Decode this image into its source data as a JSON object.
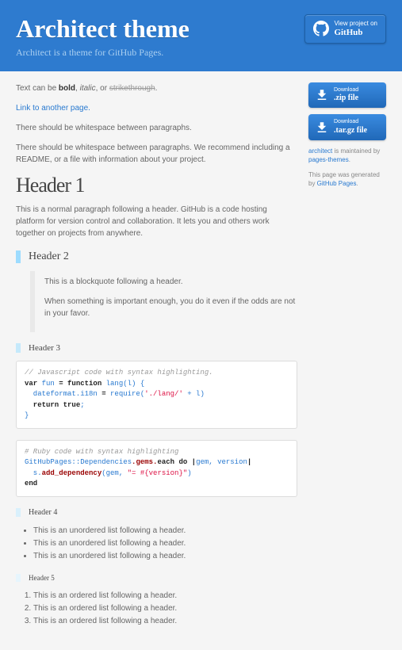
{
  "header": {
    "title": "Architect theme",
    "tagline": "Architect is a theme for GitHub Pages.",
    "github_small": "View project on",
    "github_big": "GitHub"
  },
  "intro": {
    "text_prefix": "Text can be ",
    "bold": "bold",
    "sep1": ", ",
    "italic": "italic",
    "sep2": ", or ",
    "strike": "strikethrough",
    "dot": ".",
    "link": "Link to another page.",
    "p1": "There should be whitespace between paragraphs.",
    "p2": "There should be whitespace between paragraphs. We recommend including a README, or a file with information about your project."
  },
  "h1": "Header 1",
  "h1_p": "This is a normal paragraph following a header. GitHub is a code hosting platform for version control and collaboration. It lets you and others work together on projects from anywhere.",
  "h2": "Header 2",
  "bq1": "This is a blockquote following a header.",
  "bq2": "When something is important enough, you do it even if the odds are not in your favor.",
  "h3": "Header 3",
  "code_js": {
    "c": "// Javascript code with syntax highlighting.",
    "l1a": "var",
    "l1b": " fun ",
    "l1c": "=",
    "l1d": " function",
    "l1e": " lang(l) {",
    "l2a": "  dateformat.i18n ",
    "l2b": "=",
    "l2c": " require(",
    "l2d": "'./lang/'",
    "l2e": " + l)",
    "l3a": "  return",
    "l3b": " true",
    "l3c": ";",
    "l4": "}"
  },
  "code_rb": {
    "c": "# Ruby code with syntax highlighting",
    "l1a": "GitHubPages",
    "l1b": "::",
    "l1c": "Dependencies",
    "l1d": ".gems.",
    "l1e": "each",
    "l1f": " do |",
    "l1g": "gem, version",
    "l1h": "|",
    "l2a": "  s.",
    "l2b": "add_dependency",
    "l2c": "(gem, ",
    "l2d": "\"= #{version}\"",
    "l2e": ")",
    "l3": "end"
  },
  "h4": "Header 4",
  "ul_item": "This is an unordered list following a header.",
  "h5": "Header 5",
  "ol_item": "This is an ordered list following a header.",
  "sidebar": {
    "dl_small": "Download",
    "zip": ".zip file",
    "tar": ".tar.gz file",
    "maint1": "architect",
    "maint2": " is maintained by ",
    "maint3": "pages-themes",
    "maint4": ".",
    "gen1": "This page was generated by ",
    "gen2": "GitHub Pages",
    "gen3": "."
  }
}
